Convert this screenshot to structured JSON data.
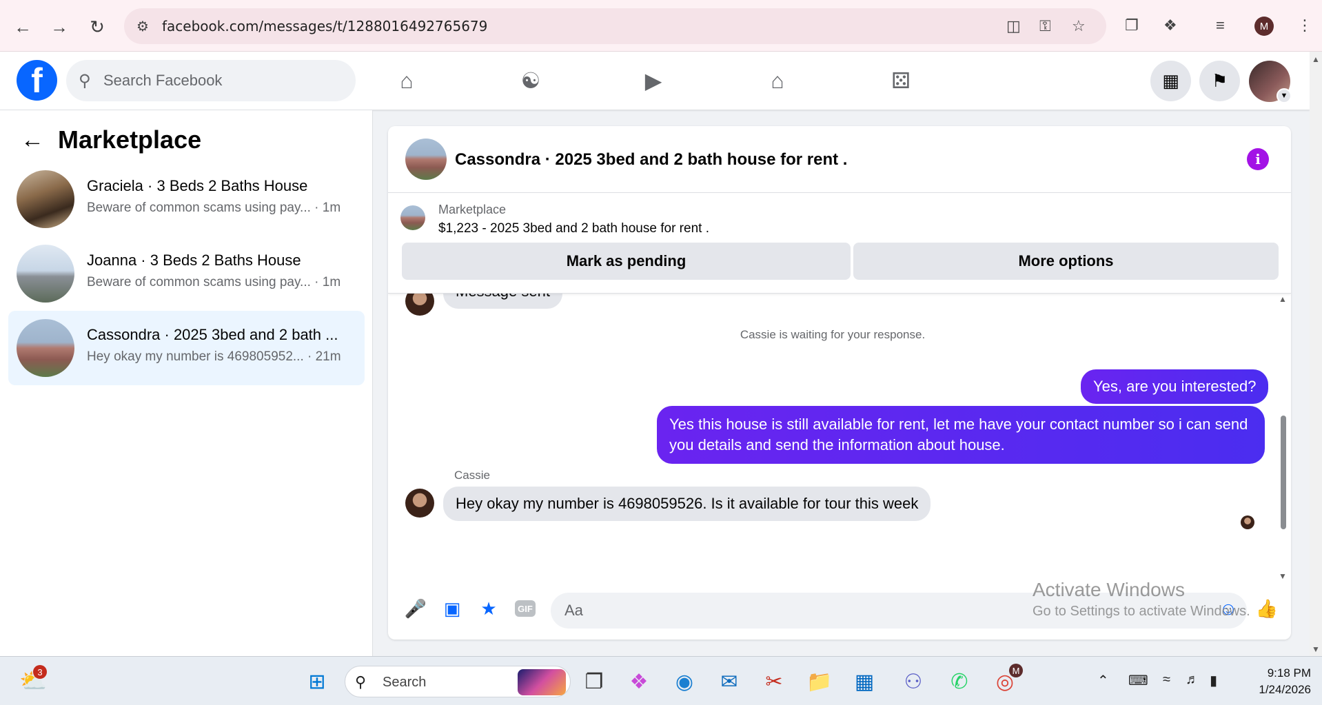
{
  "browser": {
    "url": "facebook.com/messages/t/1288016492765679",
    "profile_initial": "M"
  },
  "fb": {
    "logo": "f",
    "search_placeholder": "Search Facebook",
    "nav_icons": [
      "home-icon",
      "friends-icon",
      "video-icon",
      "marketplace-icon",
      "gaming-icon"
    ]
  },
  "sidebar": {
    "title": "Marketplace",
    "conversations": [
      {
        "name": "Graciela · 3 Beds 2 Baths House",
        "snippet": "Beware of common scams using pay...",
        "time": " · 1m",
        "active": false
      },
      {
        "name": "Joanna · 3 Beds 2 Baths House",
        "snippet": "Beware of common scams using pay...",
        "time": " · 1m",
        "active": false
      },
      {
        "name": "Cassondra · 2025 3bed and 2 bath ...",
        "snippet": "Hey okay my number is 469805952...",
        "time": " · 21m",
        "active": true
      }
    ]
  },
  "chat": {
    "title": "Cassondra · 2025 3bed and 2 bath house for rent .",
    "listing": {
      "label": "Marketplace",
      "price_title": "$1,223 - 2025 3bed and 2 bath house for rent .",
      "mark_pending": "Mark as pending",
      "more_options": "More options"
    },
    "partial_message": "Message sent",
    "system_message": "Cassie is waiting for your response.",
    "outgoing": [
      "Yes, are you interested?",
      "Yes this house is still available for rent, let me have your contact number so i can send you details and send the information about house."
    ],
    "sender_name": "Cassie",
    "incoming": "Hey okay my number is 4698059526. Is it available for tour this week",
    "composer_placeholder": "Aa",
    "gif_label": "GIF"
  },
  "watermark": {
    "line1": "Activate Windows",
    "line2": "Go to Settings to activate Windows."
  },
  "taskbar": {
    "weather_badge": "3",
    "search_label": "Search",
    "chrome_badge": "M",
    "time": "9:18 PM",
    "date": "1/24/2026"
  }
}
